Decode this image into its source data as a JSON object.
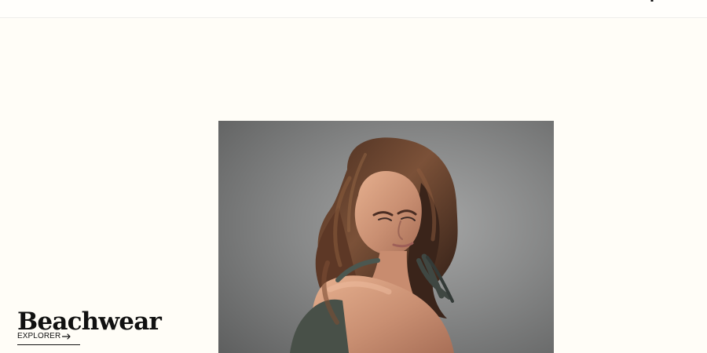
{
  "header": {
    "icon": "account-icon"
  },
  "hero": {
    "category_title": "Beachwear",
    "cta_label": "EXPLORER",
    "cta_icon": "arrow-right-icon",
    "image_subject": "model-photo"
  },
  "colors": {
    "page_background": "#fffdf7",
    "text": "#111111",
    "photo_background": "#858687"
  }
}
